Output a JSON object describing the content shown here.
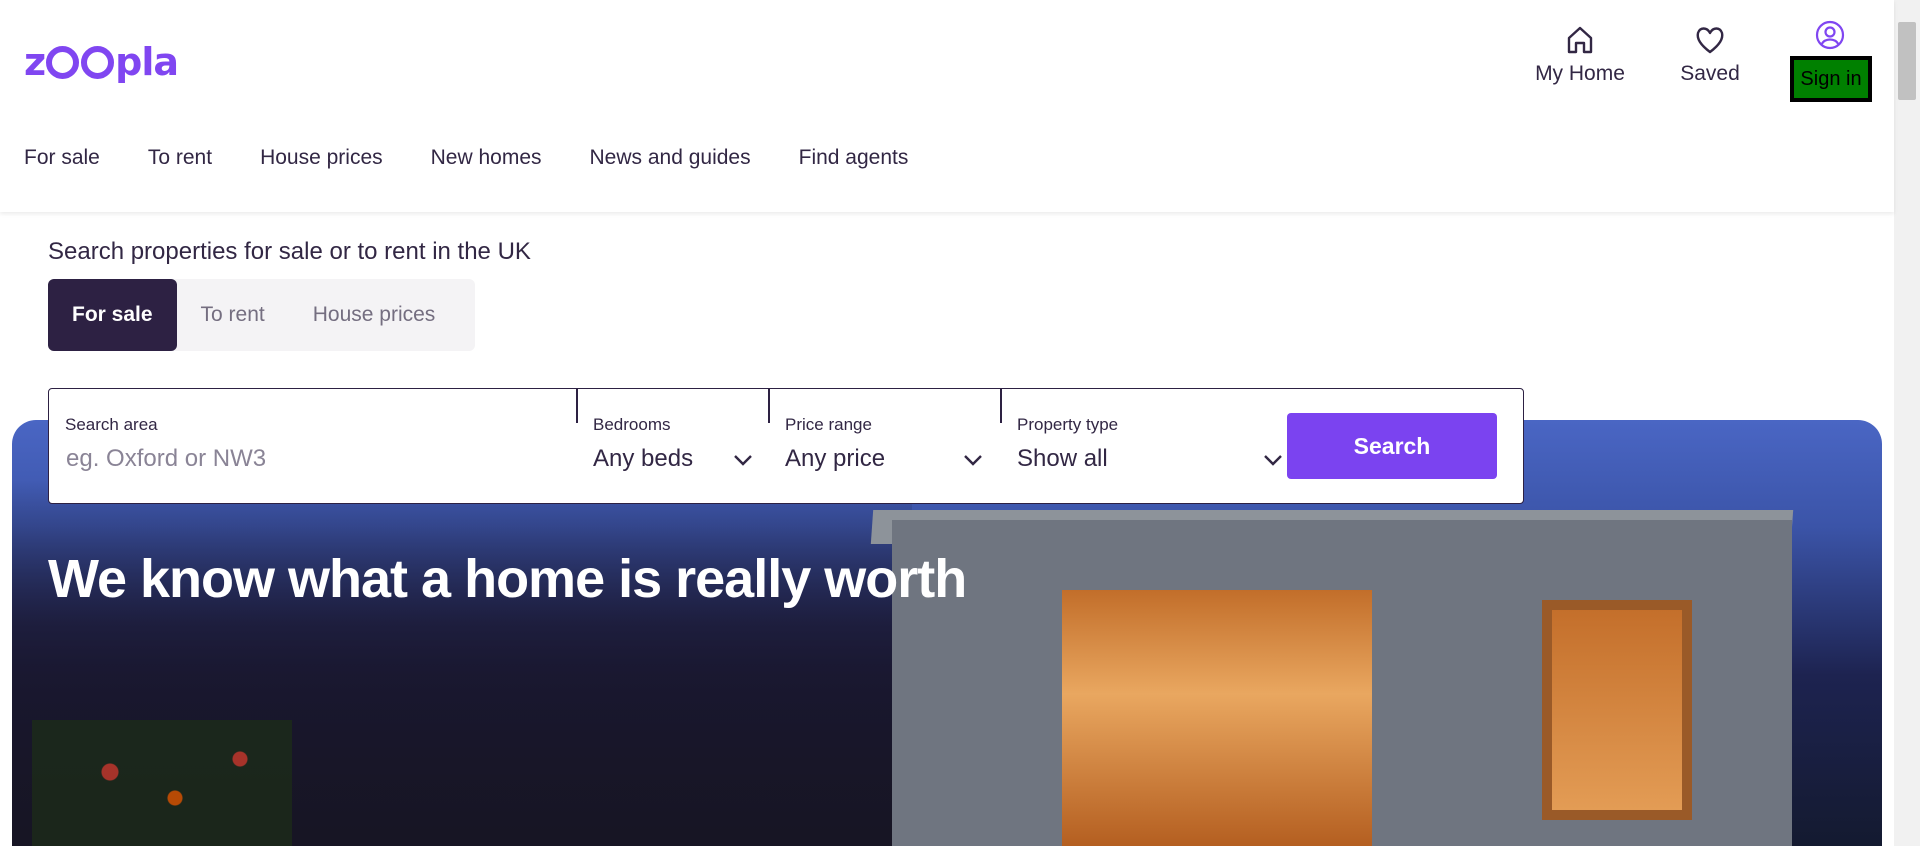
{
  "brand": {
    "logo_prefix": "z",
    "logo_suffix": "pla",
    "accent": "#8046f1"
  },
  "header_actions": {
    "my_home": "My Home",
    "saved": "Saved",
    "sign_in": "Sign in"
  },
  "nav": [
    "For sale",
    "To rent",
    "House prices",
    "New homes",
    "News and guides",
    "Find agents"
  ],
  "search": {
    "heading": "Search properties for sale or to rent in the UK",
    "tabs": [
      {
        "label": "For sale",
        "active": true
      },
      {
        "label": "To rent",
        "active": false
      },
      {
        "label": "House prices",
        "active": false
      }
    ],
    "area_label": "Search area",
    "area_placeholder": "eg. Oxford or NW3",
    "bedrooms_label": "Bedrooms",
    "bedrooms_value": "Any beds",
    "price_label": "Price range",
    "price_value": "Any price",
    "type_label": "Property type",
    "type_value": "Show all",
    "button": "Search"
  },
  "hero": {
    "title": "We know what a home is really worth"
  },
  "icons": [
    "home-icon",
    "heart-icon",
    "user-icon",
    "chevron-down-icon"
  ]
}
